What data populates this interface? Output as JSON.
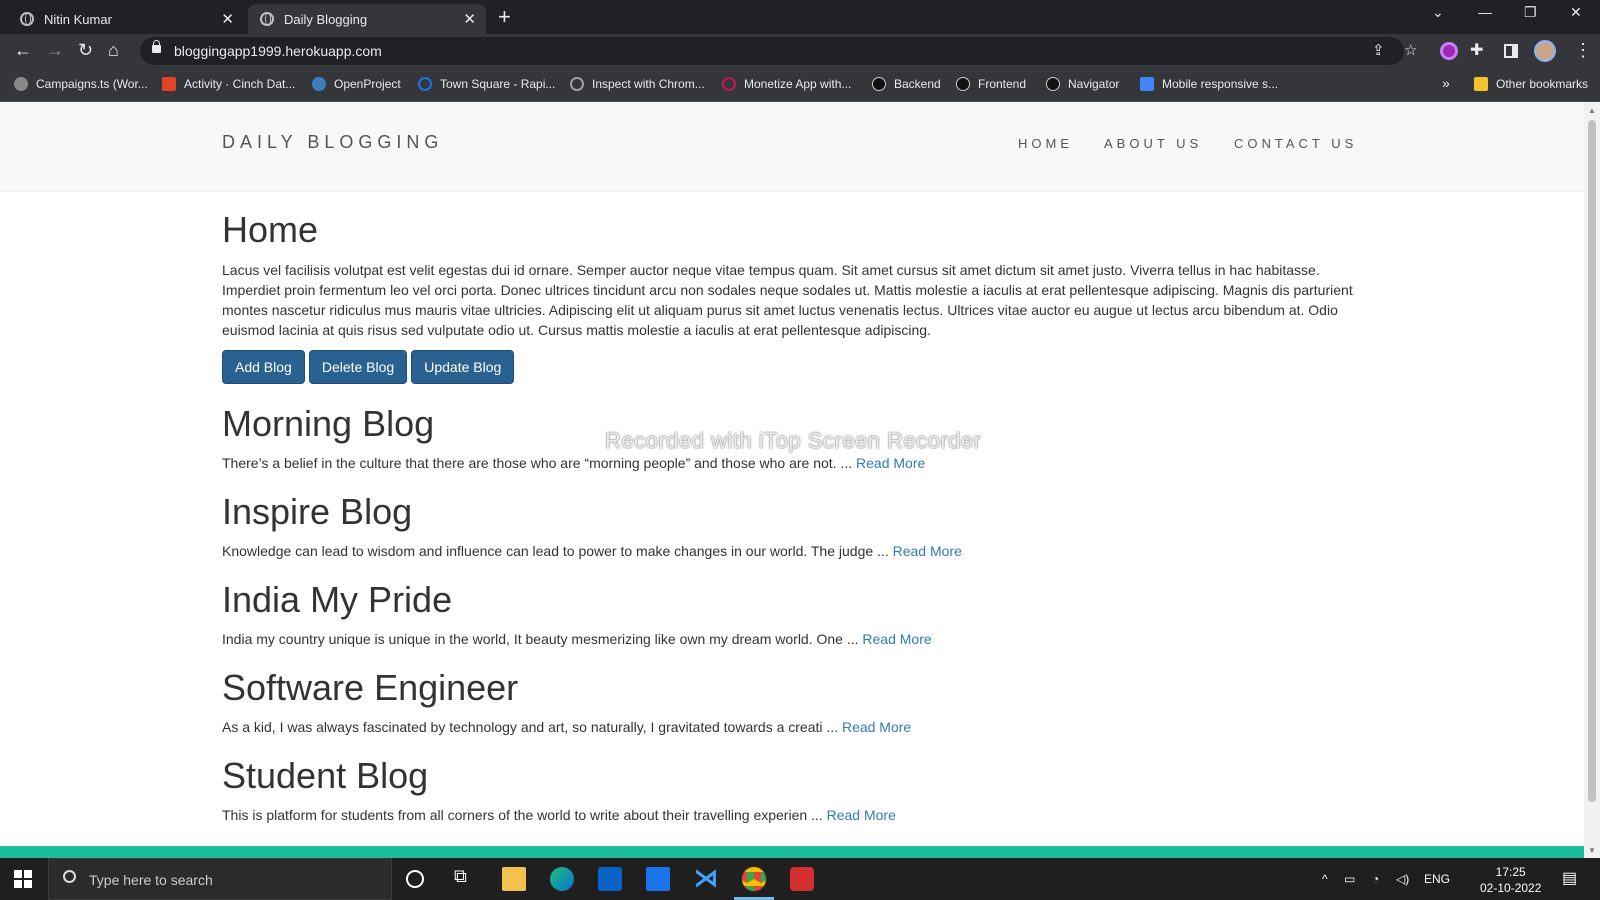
{
  "browser": {
    "tabs": [
      {
        "title": "Nitin Kumar",
        "active": false
      },
      {
        "title": "Daily Blogging",
        "active": true
      }
    ],
    "url": "bloggingapp1999.herokuapp.com",
    "bookmarks": [
      "Campaigns.ts (Wor...",
      "Activity · Cinch Dat...",
      "OpenProject",
      "Town Square - Rapi...",
      "Inspect with Chrom...",
      "Monetize App with...",
      "Backend",
      "Frontend",
      "Navigator",
      "Mobile responsive s..."
    ],
    "more_bookmarks": "»",
    "other_bookmarks": "Other bookmarks"
  },
  "site": {
    "brand": "DAILY BLOGGING",
    "nav": [
      "HOME",
      "ABOUT US",
      "CONTACT US"
    ],
    "heading": "Home",
    "intro": "Lacus vel facilisis volutpat est velit egestas dui id ornare. Semper auctor neque vitae tempus quam. Sit amet cursus sit amet dictum sit amet justo. Viverra tellus in hac habitasse. Imperdiet proin fermentum leo vel orci porta. Donec ultrices tincidunt arcu non sodales neque sodales ut. Mattis molestie a iaculis at erat pellentesque adipiscing. Magnis dis parturient montes nascetur ridiculus mus mauris vitae ultricies. Adipiscing elit ut aliquam purus sit amet luctus venenatis lectus. Ultrices vitae auctor eu augue ut lectus arcu bibendum at. Odio euismod lacinia at quis risus sed vulputate odio ut. Cursus mattis molestie a iaculis at erat pellentesque adipiscing.",
    "buttons": {
      "add": "Add Blog",
      "delete": "Delete Blog",
      "update": "Update Blog"
    },
    "posts": [
      {
        "title": "Morning Blog",
        "excerpt": "There’s a belief in the culture that there are those who are “morning people” and those who are not. ...",
        "link": "Read More"
      },
      {
        "title": "Inspire Blog",
        "excerpt": "Knowledge can lead to wisdom and influence can lead to power to make changes in our world. The judge ...",
        "link": "Read More"
      },
      {
        "title": "India My Pride",
        "excerpt": "India my country unique is unique in the world, It beauty mesmerizing like own my dream world. One ...",
        "link": "Read More"
      },
      {
        "title": "Software Engineer",
        "excerpt": "As a kid, I was always fascinated by technology and art, so naturally, I gravitated towards a creati ...",
        "link": "Read More"
      },
      {
        "title": "Student Blog",
        "excerpt": "This is platform for students from all corners of the world to write about their travelling experien ...",
        "link": "Read More"
      }
    ],
    "watermark": "Recorded with iTop Screen Recorder"
  },
  "taskbar": {
    "search_placeholder": "Type here to search",
    "lang": "ENG",
    "time": "17:25",
    "date": "02-10-2022"
  },
  "colors": {
    "button_bg": "#296191",
    "link": "#337ab7",
    "accent_bar": "#1abc9c"
  }
}
